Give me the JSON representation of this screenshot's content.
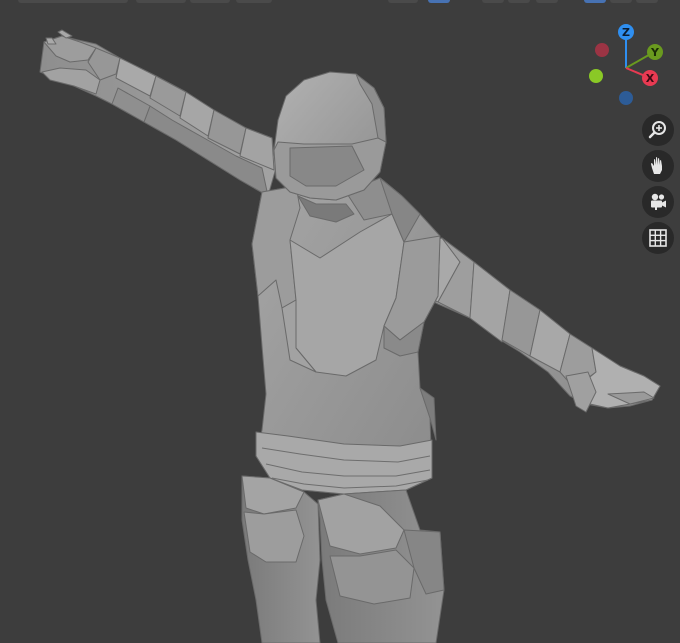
{
  "viewport": {
    "background_color": "#3d3d3d",
    "model_color": "#8f8f8f"
  },
  "top_strip": {
    "active_color": "#4772b3"
  },
  "gizmo": {
    "z_label": "Z",
    "y_label": "Y",
    "x_label": "X",
    "colors": {
      "z": "#2f8ff0",
      "y": "#6a9a1f",
      "x": "#e83a52",
      "neg_x": "#9b3444",
      "neg_y": "#8ac926",
      "neg_z": "#2d5c97"
    }
  },
  "nav_buttons": [
    {
      "icon": "zoom-icon"
    },
    {
      "icon": "pan-hand-icon"
    },
    {
      "icon": "camera-icon"
    },
    {
      "icon": "grid-icon"
    }
  ]
}
